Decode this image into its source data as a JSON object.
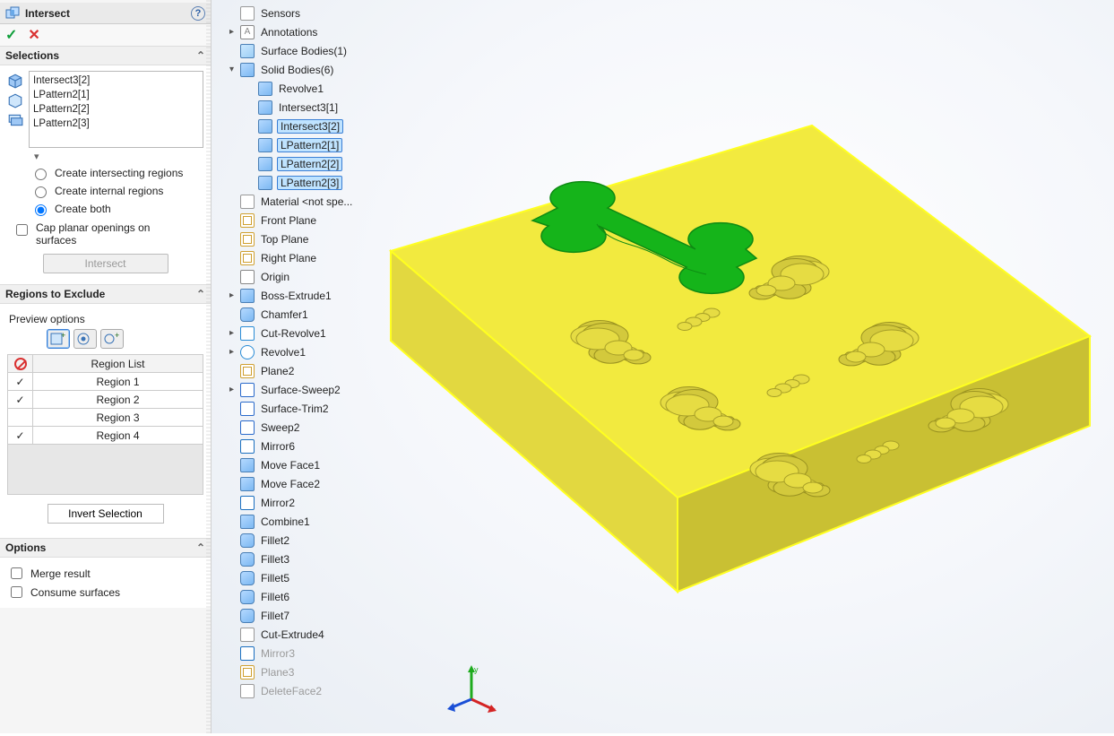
{
  "header": {
    "title": "Intersect",
    "help": "?"
  },
  "okcancel": {
    "ok": "✓",
    "cancel": "✕"
  },
  "selections": {
    "heading": "Selections",
    "items": [
      "Intersect3[2]",
      "LPattern2[1]",
      "LPattern2[2]",
      "LPattern2[3]"
    ],
    "radios": {
      "intersecting": "Create intersecting regions",
      "internal": "Create internal regions",
      "both": "Create both",
      "selected": "both"
    },
    "cap_label": "Cap planar openings on surfaces",
    "intersect_btn": "Intersect"
  },
  "regions": {
    "heading": "Regions to Exclude",
    "preview_label": "Preview options",
    "list_header": "Region List",
    "rows": [
      {
        "label": "Region   1",
        "checked": true
      },
      {
        "label": "Region   2",
        "checked": true
      },
      {
        "label": "Region   3",
        "checked": false
      },
      {
        "label": "Region   4",
        "checked": true
      }
    ],
    "invert_btn": "Invert Selection"
  },
  "options": {
    "heading": "Options",
    "merge": "Merge result",
    "consume": "Consume surfaces"
  },
  "tree": [
    {
      "depth": 0,
      "tw": "",
      "icon": "sensor",
      "label": "Sensors",
      "sel": false,
      "dim": false
    },
    {
      "depth": 0,
      "tw": "▸",
      "icon": "ann",
      "label": "Annotations"
    },
    {
      "depth": 0,
      "tw": "",
      "icon": "surf",
      "label": "Surface Bodies(1)"
    },
    {
      "depth": 0,
      "tw": "▾",
      "icon": "folder",
      "label": "Solid Bodies(6)"
    },
    {
      "depth": 1,
      "tw": "",
      "icon": "cube",
      "label": "Revolve1"
    },
    {
      "depth": 1,
      "tw": "",
      "icon": "cube",
      "label": "Intersect3[1]"
    },
    {
      "depth": 1,
      "tw": "",
      "icon": "cube",
      "label": "Intersect3[2]",
      "sel": true
    },
    {
      "depth": 1,
      "tw": "",
      "icon": "cube",
      "label": "LPattern2[1]",
      "sel": true
    },
    {
      "depth": 1,
      "tw": "",
      "icon": "cube",
      "label": "LPattern2[2]",
      "sel": true
    },
    {
      "depth": 1,
      "tw": "",
      "icon": "cube",
      "label": "LPattern2[3]",
      "sel": true
    },
    {
      "depth": 0,
      "tw": "",
      "icon": "mat",
      "label": "Material <not spe..."
    },
    {
      "depth": 0,
      "tw": "",
      "icon": "plane",
      "label": "Front Plane"
    },
    {
      "depth": 0,
      "tw": "",
      "icon": "plane",
      "label": "Top Plane"
    },
    {
      "depth": 0,
      "tw": "",
      "icon": "plane",
      "label": "Right Plane"
    },
    {
      "depth": 0,
      "tw": "",
      "icon": "origin",
      "label": "Origin"
    },
    {
      "depth": 0,
      "tw": "▸",
      "icon": "cube",
      "label": "Boss-Extrude1"
    },
    {
      "depth": 0,
      "tw": "",
      "icon": "fillet",
      "label": "Chamfer1"
    },
    {
      "depth": 0,
      "tw": "▸",
      "icon": "cut",
      "label": "Cut-Revolve1"
    },
    {
      "depth": 0,
      "tw": "▸",
      "icon": "rev",
      "label": "Revolve1"
    },
    {
      "depth": 0,
      "tw": "",
      "icon": "plane",
      "label": "Plane2"
    },
    {
      "depth": 0,
      "tw": "▸",
      "icon": "sweep",
      "label": "Surface-Sweep2"
    },
    {
      "depth": 0,
      "tw": "",
      "icon": "sweep",
      "label": "Surface-Trim2"
    },
    {
      "depth": 0,
      "tw": "",
      "icon": "sweep",
      "label": "Sweep2"
    },
    {
      "depth": 0,
      "tw": "",
      "icon": "mirror",
      "label": "Mirror6"
    },
    {
      "depth": 0,
      "tw": "",
      "icon": "move",
      "label": "Move Face1"
    },
    {
      "depth": 0,
      "tw": "",
      "icon": "move",
      "label": "Move Face2"
    },
    {
      "depth": 0,
      "tw": "",
      "icon": "mirror",
      "label": "Mirror2"
    },
    {
      "depth": 0,
      "tw": "",
      "icon": "combine",
      "label": "Combine1"
    },
    {
      "depth": 0,
      "tw": "",
      "icon": "fillet",
      "label": "Fillet2"
    },
    {
      "depth": 0,
      "tw": "",
      "icon": "fillet",
      "label": "Fillet3"
    },
    {
      "depth": 0,
      "tw": "",
      "icon": "fillet",
      "label": "Fillet5"
    },
    {
      "depth": 0,
      "tw": "",
      "icon": "fillet",
      "label": "Fillet6"
    },
    {
      "depth": 0,
      "tw": "",
      "icon": "fillet",
      "label": "Fillet7"
    },
    {
      "depth": 0,
      "tw": "",
      "icon": "cutx",
      "label": "Cut-Extrude4"
    },
    {
      "depth": 0,
      "tw": "",
      "icon": "mirror",
      "label": "Mirror3",
      "dim": true
    },
    {
      "depth": 0,
      "tw": "",
      "icon": "plane",
      "label": "Plane3",
      "dim": true
    },
    {
      "depth": 0,
      "tw": "",
      "icon": "cutx",
      "label": "DeleteFace2",
      "dim": true
    }
  ],
  "colors": {
    "model_top": "#f2ea3f",
    "model_side": "#c9c033",
    "model_front": "#e2d840",
    "green": "#15b41a",
    "select_edge": "#ffff20"
  }
}
